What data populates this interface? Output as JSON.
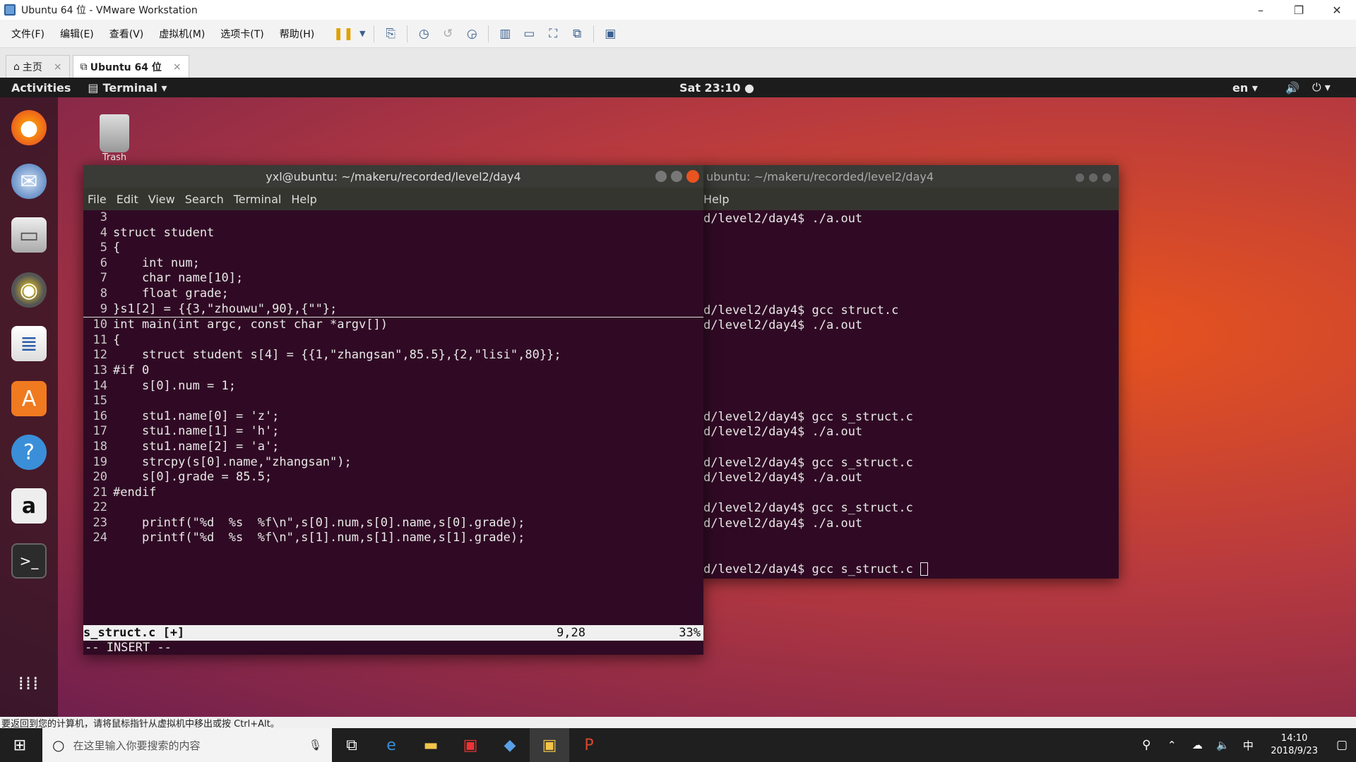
{
  "window": {
    "title": "Ubuntu 64 位 - VMware Workstation",
    "minimize": "–",
    "restore": "❐",
    "close": "✕"
  },
  "menu": [
    "文件(F)",
    "编辑(E)",
    "查看(V)",
    "虚拟机(M)",
    "选项卡(T)",
    "帮助(H)"
  ],
  "toolbar_icons": [
    "pause-icon",
    "dropdown-icon",
    "send-keys-icon",
    "snapshot-icon",
    "revert-snapshot-icon",
    "snapshot-manager-icon",
    "sidebar-icon",
    "thumbnail-icon",
    "fullscreen-icon",
    "unity-icon",
    "console-view-icon"
  ],
  "tabs": [
    {
      "label": "主页",
      "close": "×"
    },
    {
      "label": "Ubuntu 64 位",
      "close": "×"
    }
  ],
  "gnome": {
    "activities": "Activities",
    "app_menu": "Terminal ▾",
    "clock": "Sat 23:10 ●",
    "lang": "en ▾",
    "volume": "🔊",
    "power": "⏻ ▾"
  },
  "desktop": {
    "trash_label": "Trash"
  },
  "dock": [
    "firefox-icon",
    "thunderbird-icon",
    "files-icon",
    "rhythmbox-icon",
    "writer-icon",
    "software-icon",
    "help-icon",
    "amazon-icon",
    "terminal-icon",
    "show-apps-icon"
  ],
  "term1": {
    "title": "yxl@ubuntu: ~/makeru/recorded/level2/day4",
    "menu": [
      "File",
      "Edit",
      "View",
      "Search",
      "Terminal",
      "Help"
    ],
    "lines": [
      [
        "3",
        ""
      ],
      [
        "4",
        "struct student"
      ],
      [
        "5",
        "{"
      ],
      [
        "6",
        "    int num;"
      ],
      [
        "7",
        "    char name[10];"
      ],
      [
        "8",
        "    float grade;"
      ],
      [
        "9",
        "}s1[2] = {{3,\"zhouwu\",90},{\"\"};"
      ],
      [
        "10",
        "int main(int argc, const char *argv[])"
      ],
      [
        "11",
        "{"
      ],
      [
        "12",
        "    struct student s[4] = {{1,\"zhangsan\",85.5},{2,\"lisi\",80}};"
      ],
      [
        "13",
        "#if 0"
      ],
      [
        "14",
        "    s[0].num = 1;"
      ],
      [
        "15",
        ""
      ],
      [
        "16",
        "    stu1.name[0] = 'z';"
      ],
      [
        "17",
        "    stu1.name[1] = 'h';"
      ],
      [
        "18",
        "    stu1.name[2] = 'a';"
      ],
      [
        "19",
        "    strcpy(s[0].name,\"zhangsan\");"
      ],
      [
        "20",
        "    s[0].grade = 85.5;"
      ],
      [
        "21",
        "#endif"
      ],
      [
        "22",
        ""
      ],
      [
        "23",
        "    printf(\"%d  %s  %f\\n\",s[0].num,s[0].name,s[0].grade);"
      ],
      [
        "24",
        "    printf(\"%d  %s  %f\\n\",s[1].num,s[1].name,s[1].grade);"
      ]
    ],
    "status_file": "s_struct.c [+]",
    "status_pos": "9,28",
    "status_pct": "33%",
    "mode": "-- INSERT --"
  },
  "term2": {
    "title": "ubuntu: ~/makeru/recorded/level2/day4",
    "menu": [
      "Help"
    ],
    "lines": [
      "d/level2/day4$ ./a.out",
      "",
      "",
      "",
      "",
      "",
      "d/level2/day4$ gcc struct.c",
      "d/level2/day4$ ./a.out",
      "",
      "",
      "",
      "",
      "",
      "d/level2/day4$ gcc s_struct.c",
      "d/level2/day4$ ./a.out",
      "",
      "d/level2/day4$ gcc s_struct.c",
      "d/level2/day4$ ./a.out",
      "",
      "d/level2/day4$ gcc s_struct.c",
      "d/level2/day4$ ./a.out",
      "",
      "",
      "d/level2/day4$ gcc s_struct.c "
    ]
  },
  "statusbar": "要返回到您的计算机，请将鼠标指针从虚拟机中移出或按 Ctrl+Alt。",
  "taskbar": {
    "search_placeholder": "在这里输入你要搜索的内容",
    "time": "14:10",
    "date": "2018/9/23",
    "ime": "中"
  },
  "colors": {
    "terminal_bg": "#300a24",
    "ubuntu_orange": "#e8541d",
    "taskbar": "#1f1f1f"
  }
}
